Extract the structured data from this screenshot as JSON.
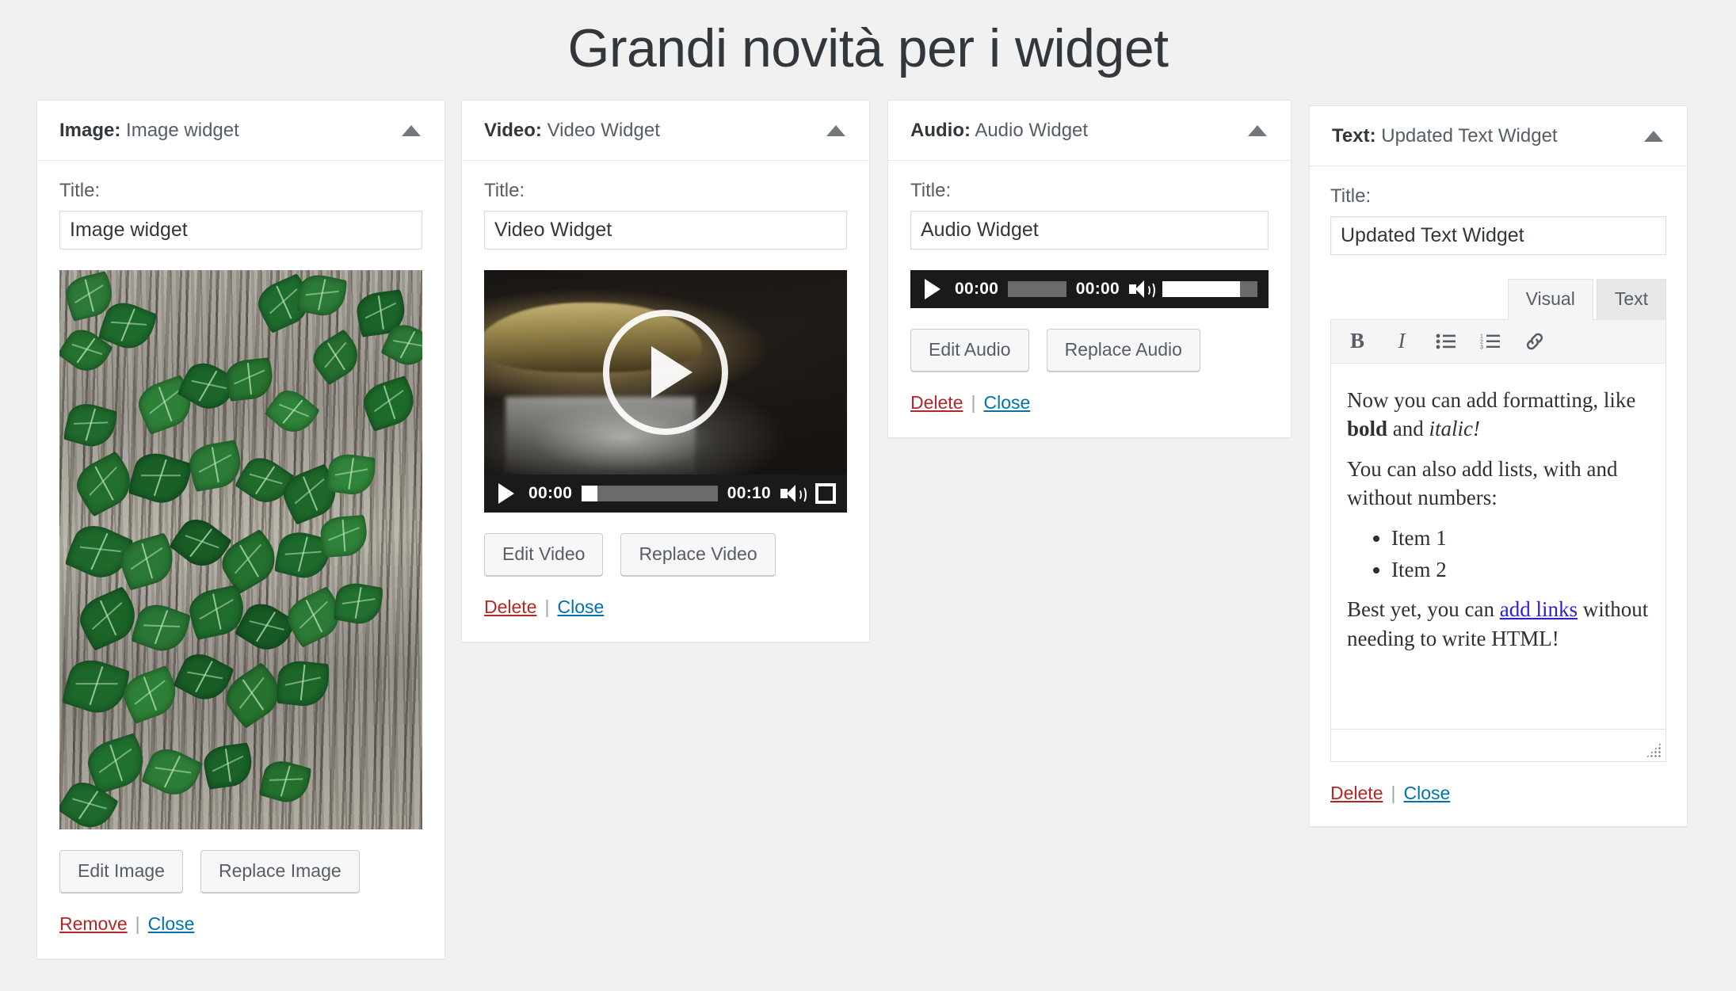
{
  "page": {
    "title": "Grandi novità per i widget"
  },
  "widgets": [
    {
      "id": "image",
      "header_type": "Image:",
      "header_name": "Image widget",
      "title_label": "Title:",
      "title_value": "Image widget",
      "media_alt": "Green ivy leaves growing on grey tree bark",
      "buttons": [
        "Edit Image",
        "Replace Image"
      ],
      "delete_label": "Remove",
      "separator": "|",
      "close_label": "Close"
    },
    {
      "id": "video",
      "header_type": "Video:",
      "header_name": "Video Widget",
      "title_label": "Title:",
      "title_value": "Video Widget",
      "media_alt": "Water flowing over a mossy stone ledge in a dark scene",
      "player": {
        "play_icon": "play-icon",
        "current_time": "00:00",
        "duration": "00:10",
        "volume_icon": "volume-icon",
        "fullscreen_icon": "fullscreen-icon"
      },
      "buttons": [
        "Edit Video",
        "Replace Video"
      ],
      "delete_label": "Delete",
      "separator": "|",
      "close_label": "Close"
    },
    {
      "id": "audio",
      "header_type": "Audio:",
      "header_name": "Audio Widget",
      "title_label": "Title:",
      "title_value": "Audio Widget",
      "player": {
        "play_icon": "play-icon",
        "current_time": "00:00",
        "duration": "00:00",
        "volume_icon": "volume-icon",
        "volume_level": "82"
      },
      "buttons": [
        "Edit Audio",
        "Replace Audio"
      ],
      "delete_label": "Delete",
      "separator": "|",
      "close_label": "Close"
    },
    {
      "id": "text",
      "header_type": "Text:",
      "header_name": "Updated Text Widget",
      "title_label": "Title:",
      "title_value": "Updated Text Widget",
      "editor": {
        "tabs": [
          {
            "label": "Visual",
            "active": true
          },
          {
            "label": "Text",
            "active": false
          }
        ],
        "toolbar": [
          {
            "icon": "bold-icon",
            "glyph": "B"
          },
          {
            "icon": "italic-icon",
            "glyph": "I"
          },
          {
            "icon": "unordered-list-icon",
            "glyph": ""
          },
          {
            "icon": "ordered-list-icon",
            "glyph": ""
          },
          {
            "icon": "link-icon",
            "glyph": ""
          }
        ],
        "content": {
          "para1_before_bold": "Now you can add formatting, like ",
          "para1_bold": "bold",
          "para1_between": " and ",
          "para1_italic": "italic!",
          "para2": "You can also add lists, with and without numbers:",
          "list_items": [
            "Item 1",
            "Item 2"
          ],
          "para3_before_link": "Best yet, you can ",
          "para3_link": "add links",
          "para3_after_link": " without needing to write HTML!"
        },
        "resize_handle": "resize-handle"
      },
      "delete_label": "Delete",
      "separator": "|",
      "close_label": "Close"
    }
  ],
  "colors": {
    "page_background": "#f1f1f1",
    "panel_background": "#ffffff",
    "panel_border": "#e5e5e5",
    "heading_text": "#32373c",
    "muted_text": "#555d66",
    "delete_link": "#b52727",
    "close_link": "#0073aa",
    "editor_link": "#2a20d6",
    "media_bar": "#1a1a1a"
  }
}
